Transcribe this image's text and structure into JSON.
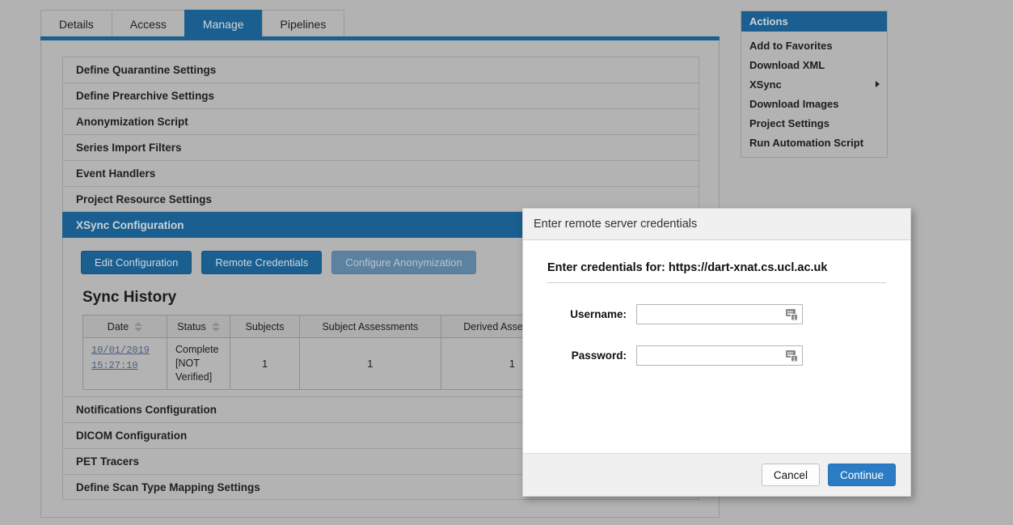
{
  "tabs": [
    {
      "label": "Details",
      "active": false
    },
    {
      "label": "Access",
      "active": false
    },
    {
      "label": "Manage",
      "active": true
    },
    {
      "label": "Pipelines",
      "active": false
    }
  ],
  "accordion": {
    "items_top": [
      {
        "label": "Define Quarantine Settings"
      },
      {
        "label": "Define Prearchive Settings"
      },
      {
        "label": "Anonymization Script"
      },
      {
        "label": "Series Import Filters"
      },
      {
        "label": "Event Handlers"
      },
      {
        "label": "Project Resource Settings"
      }
    ],
    "active_item": {
      "label": "XSync Configuration"
    },
    "items_bottom": [
      {
        "label": "Notifications Configuration"
      },
      {
        "label": "DICOM Configuration"
      },
      {
        "label": "PET Tracers"
      },
      {
        "label": "Define Scan Type Mapping Settings"
      }
    ]
  },
  "xsync_panel": {
    "buttons": [
      {
        "label": "Edit Configuration",
        "disabled": false
      },
      {
        "label": "Remote Credentials",
        "disabled": false
      },
      {
        "label": "Configure Anonymization",
        "disabled": true
      }
    ],
    "sync_history_title": "Sync History",
    "table": {
      "columns": [
        {
          "label": "Date",
          "sortable": true
        },
        {
          "label": "Status",
          "sortable": true
        },
        {
          "label": "Subjects",
          "sortable": false
        },
        {
          "label": "Subject Assessments",
          "sortable": false
        },
        {
          "label": "Derived Assessments",
          "sortable": false
        }
      ],
      "rows": [
        {
          "date_line1": "10/01/2019",
          "date_line2": "15:27:10",
          "status": "Complete [NOT Verified]",
          "subjects": "1",
          "subject_assessments": "1",
          "derived_assessments": "1"
        }
      ]
    }
  },
  "actions": {
    "title": "Actions",
    "items": [
      {
        "label": "Add to Favorites",
        "submenu": false
      },
      {
        "label": "Download XML",
        "submenu": false
      },
      {
        "label": "XSync",
        "submenu": true
      },
      {
        "label": "Download Images",
        "submenu": false
      },
      {
        "label": "Project Settings",
        "submenu": false
      },
      {
        "label": "Run Automation Script",
        "submenu": false
      }
    ]
  },
  "modal": {
    "title": "Enter remote server credentials",
    "subtitle": "Enter credentials for: https://dart-xnat.cs.ucl.ac.uk",
    "username": {
      "label": "Username:",
      "value": "",
      "placeholder": ""
    },
    "password": {
      "label": "Password:",
      "value": "",
      "placeholder": ""
    },
    "form_fill_badge": "1",
    "cancel_label": "Cancel",
    "continue_label": "Continue"
  },
  "colors": {
    "accent_blue": "#1a5f8f",
    "page_background": "#b2b2b2",
    "primary_button": "#2b7cc4",
    "link": "#4a5f80"
  }
}
